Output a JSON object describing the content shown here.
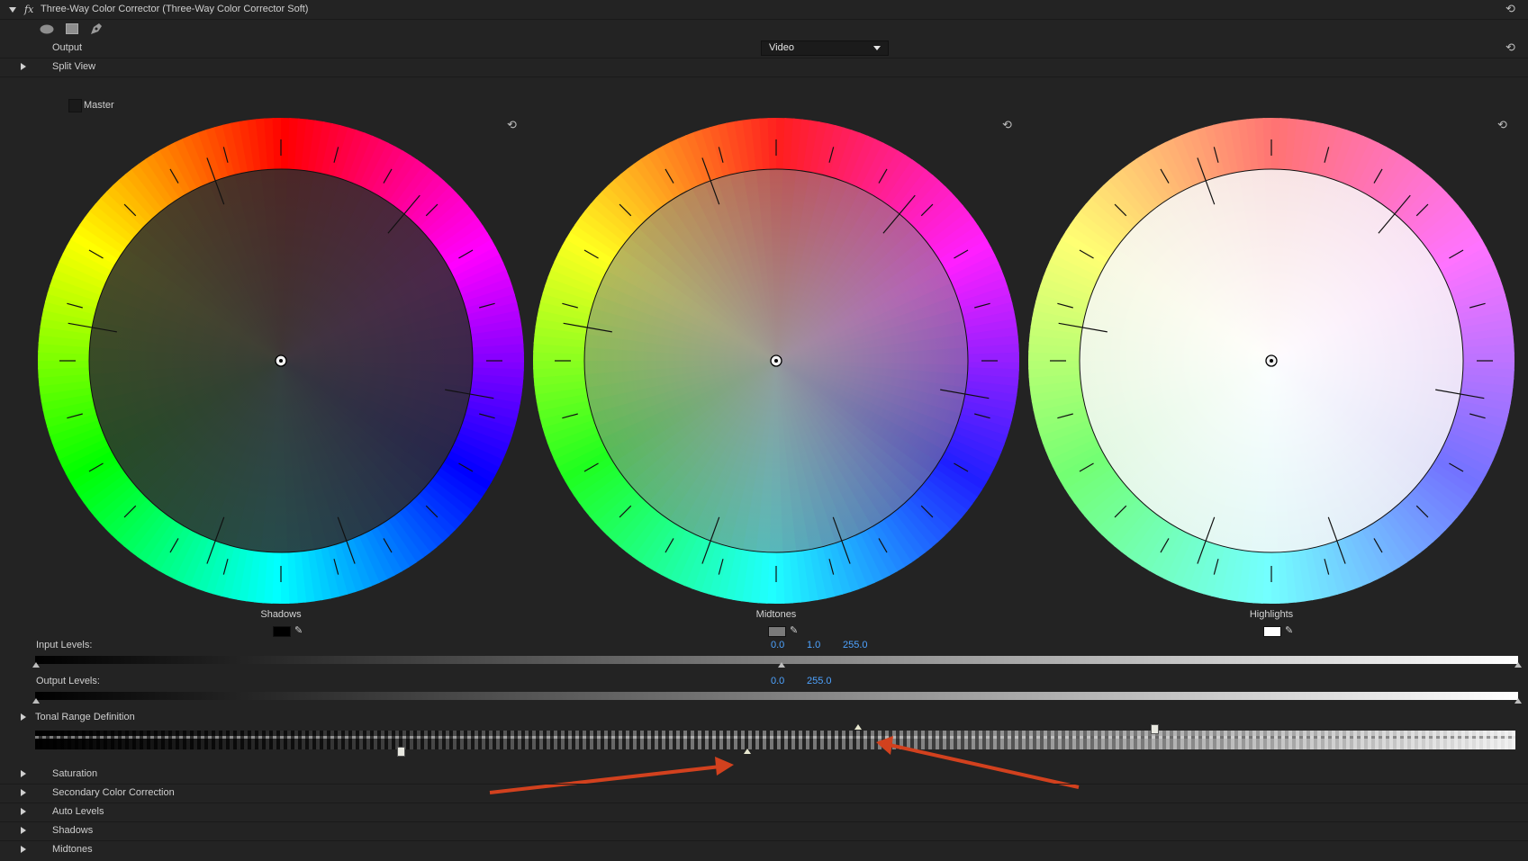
{
  "effect": {
    "fx_label": "fx",
    "title": "Three-Way Color Corrector (Three-Way Color Corrector Soft)"
  },
  "output": {
    "label": "Output",
    "selected": "Video"
  },
  "split_view": {
    "label": "Split View"
  },
  "master": {
    "label": "Master"
  },
  "wheels": [
    {
      "label": "Shadows",
      "swatch_color": "#000000"
    },
    {
      "label": "Midtones",
      "swatch_color": "#7a7a7a"
    },
    {
      "label": "Highlights",
      "swatch_color": "#ffffff"
    }
  ],
  "input_levels": {
    "label": "Input Levels:",
    "black": "0.0",
    "gamma": "1.0",
    "white": "255.0"
  },
  "output_levels": {
    "label": "Output Levels:",
    "black": "0.0",
    "white": "255.0"
  },
  "tonal_range": {
    "label": "Tonal Range Definition"
  },
  "sections": [
    {
      "label": "Saturation"
    },
    {
      "label": "Secondary Color Correction"
    },
    {
      "label": "Auto Levels"
    },
    {
      "label": "Shadows"
    },
    {
      "label": "Midtones"
    }
  ],
  "colors": {
    "panel_bg": "#232323",
    "accent_value": "#4ea3ff",
    "annotation_arrow": "#d2411e"
  },
  "icons": {
    "ellipse_mask": "ellipse-mask-icon",
    "rect_mask": "rectangle-mask-icon",
    "pen_mask": "pen-mask-icon",
    "reset": "reset-icon",
    "eyedropper": "eyedropper-icon"
  }
}
